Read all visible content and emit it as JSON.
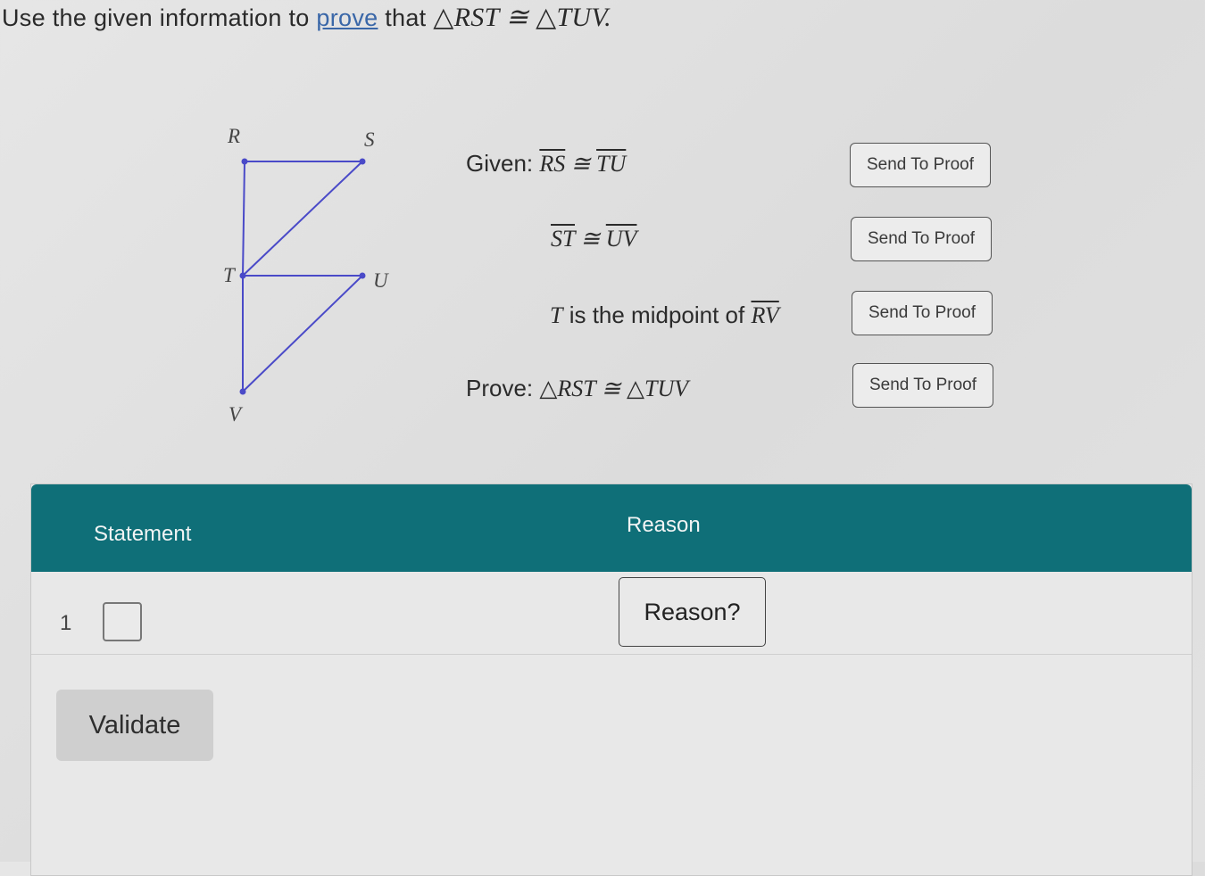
{
  "instruction": {
    "prefix": "Use the given information to ",
    "link": "prove",
    "middle": " that ",
    "tri1": "△RST",
    "congruent": " ≅ ",
    "tri2": "△TUV."
  },
  "diagram": {
    "points": {
      "R": "R",
      "S": "S",
      "T": "T",
      "U": "U",
      "V": "V"
    },
    "line_color": "#4a4ac8"
  },
  "given": {
    "line1": {
      "label": "Given: ",
      "seg1": "RS",
      "cong": " ≅ ",
      "seg2": "TU"
    },
    "line2": {
      "seg1": "ST",
      "cong": " ≅ ",
      "seg2": "UV"
    },
    "line3": {
      "var": "T",
      "text": " is the midpoint of ",
      "seg": "RV"
    },
    "prove": {
      "label": "Prove: ",
      "statement": "△RST ≅ △TUV"
    }
  },
  "buttons": {
    "send1": "Send To Proof",
    "send2": "Send To Proof",
    "send3": "Send To Proof",
    "send4": "Send To Proof"
  },
  "table": {
    "header_color": "#0f6f78",
    "statement_header": "Statement",
    "reason_header": "Reason",
    "rows": [
      {
        "number": "1",
        "reason_label": "Reason?"
      }
    ]
  },
  "validate_label": "Validate"
}
